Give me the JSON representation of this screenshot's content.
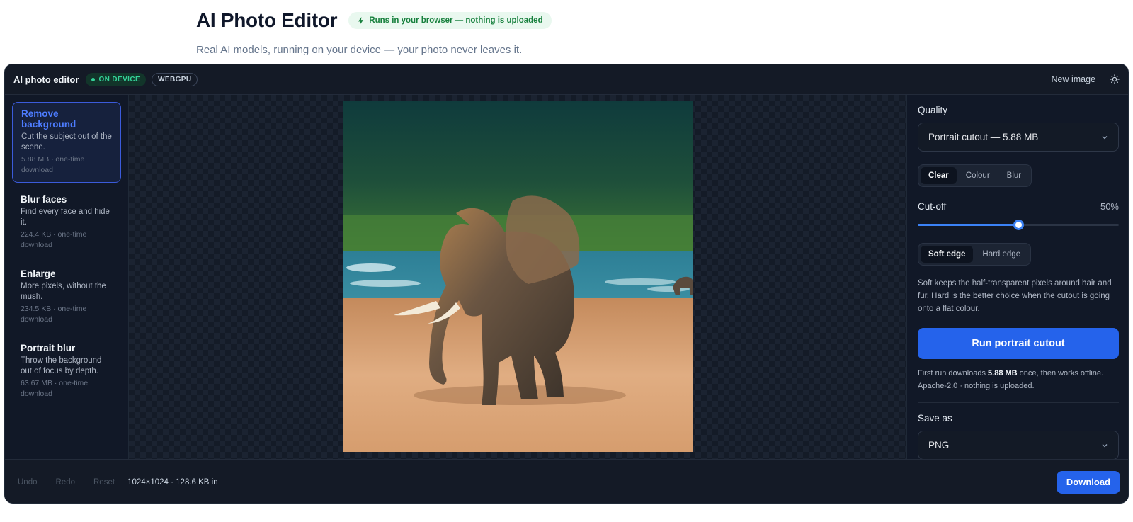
{
  "page": {
    "title": "AI Photo Editor",
    "privacy_pill": "Runs in your browser — nothing is uploaded",
    "subtitle": "Real AI models, running on your device — your photo never leaves it."
  },
  "topbar": {
    "app_name": "AI photo editor",
    "device_badge": "ON DEVICE",
    "backend_badge": "WEBGPU",
    "new_image_label": "New image",
    "theme_icon": "sun-icon"
  },
  "tools": [
    {
      "name": "Remove background",
      "desc": "Cut the subject out of the scene.",
      "size": "5.88 MB · one-time download",
      "active": true
    },
    {
      "name": "Blur faces",
      "desc": "Find every face and hide it.",
      "size": "224.4 KB · one-time download",
      "active": false
    },
    {
      "name": "Enlarge",
      "desc": "More pixels, without the mush.",
      "size": "234.5 KB · one-time download",
      "active": false
    },
    {
      "name": "Portrait blur",
      "desc": "Throw the background out of focus by depth.",
      "size": "63.67 MB · one-time download",
      "active": false
    }
  ],
  "panel": {
    "quality_label": "Quality",
    "quality_value": "Portrait cutout — 5.88 MB",
    "background_modes": [
      "Clear",
      "Colour",
      "Blur"
    ],
    "background_selected": "Clear",
    "cutoff_label": "Cut-off",
    "cutoff_value_text": "50%",
    "cutoff_fraction": 0.5,
    "edge_modes": [
      "Soft edge",
      "Hard edge"
    ],
    "edge_selected": "Soft edge",
    "edge_help": "Soft keeps the half-transparent pixels around hair and fur. Hard is the better choice when the cutout is going onto a flat colour.",
    "run_label": "Run portrait cutout",
    "note_prefix": "First run downloads ",
    "note_size": "5.88 MB",
    "note_suffix": " once, then works offline. Apache-2.0 · nothing is uploaded.",
    "save_label": "Save as",
    "save_value": "PNG"
  },
  "footer": {
    "undo": "Undo",
    "redo": "Redo",
    "reset": "Reset",
    "image_meta": "1024×1024 · 128.6 KB in",
    "download": "Download"
  },
  "colors": {
    "accent": "#2563eb",
    "active_tool": "#4d7cfe",
    "on_device": "#34d399",
    "app_bg": "#111827"
  }
}
